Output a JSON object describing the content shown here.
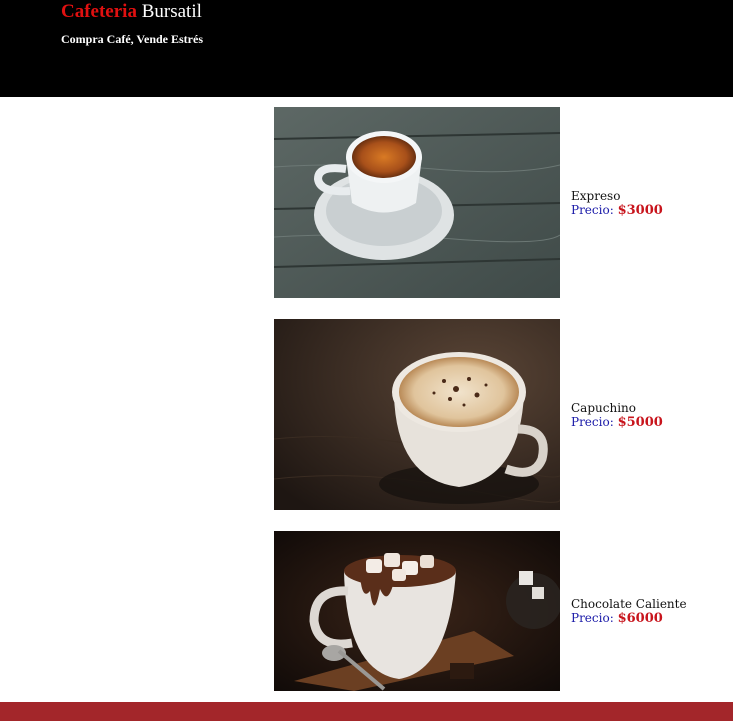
{
  "header": {
    "brand_red": "Cafeteria",
    "brand_rest": "Bursatil",
    "tagline": "Compra Café, Vende Estrés",
    "background": "#000000",
    "brand_accent": "#e01010"
  },
  "products": [
    {
      "name": "Expreso",
      "price_label": "Precio:",
      "price": "$3000"
    },
    {
      "name": "Capuchino",
      "price_label": "Precio:",
      "price": "$5000"
    },
    {
      "name": "Chocolate Caliente",
      "price_label": "Precio:",
      "price": "$6000"
    }
  ],
  "colors": {
    "price_label": "#1a1aa8",
    "price_value": "#c8141c",
    "footer": "#a3262a"
  }
}
